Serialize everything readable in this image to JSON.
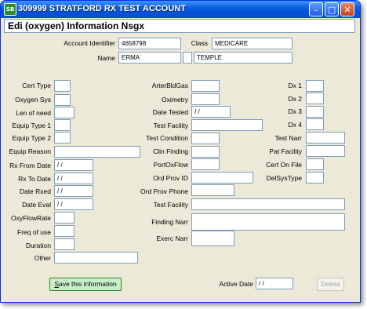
{
  "window": {
    "title": "309999 STRATFORD RX TEST ACCOUNT",
    "app_icon": "SB",
    "minimize_glyph": "–",
    "maximize_glyph": "□",
    "close_glyph": "✕"
  },
  "header": {
    "title": "Edi (oxygen) Information Nsgx"
  },
  "account": {
    "identifier_label": "Account Identifier",
    "identifier_value": "4658798",
    "class_label": "Class",
    "class_value": "MEDICARE",
    "name_label": "Name",
    "first_name": "ERMA",
    "middle_initial": "",
    "last_name": "TEMPLE"
  },
  "left_fields": {
    "cert_type": {
      "label": "Cert Type",
      "value": ""
    },
    "oxygen_sys": {
      "label": "Oxygen Sys",
      "value": ""
    },
    "len_of_need": {
      "label": "Len of need",
      "value": ""
    },
    "equip_type_1": {
      "label": "Equip  Type 1",
      "value": ""
    },
    "equip_type_2": {
      "label": "Equip  Type  2",
      "value": ""
    },
    "equip_reason": {
      "label": "Equip Reason",
      "value": ""
    },
    "rx_from_date": {
      "label": "Rx From Date",
      "value": " / /"
    },
    "rx_to_date": {
      "label": "Rx To Date",
      "value": " / /"
    },
    "date_rxed": {
      "label": "Date Rxed",
      "value": " / /"
    },
    "date_eval": {
      "label": "Date Eval",
      "value": " / /"
    },
    "oxy_flow_rate": {
      "label": "OxyFlowRate",
      "value": ""
    },
    "freq_of_use": {
      "label": "Freq of use",
      "value": ""
    },
    "duration": {
      "label": "Duration",
      "value": ""
    },
    "other": {
      "label": "Other",
      "value": ""
    }
  },
  "middle_fields": {
    "arter_bld_gas": {
      "label": "ArterBldGas",
      "value": ""
    },
    "oximetry": {
      "label": "Oximetry",
      "value": ""
    },
    "date_tested": {
      "label": "Date Tested",
      "value": " / /"
    },
    "test_facility": {
      "label": "Test Facility",
      "value": ""
    },
    "test_condition": {
      "label": "Test Condition",
      "value": ""
    },
    "clin_finding": {
      "label": "Clin Finding",
      "value": ""
    },
    "port_ox_flow": {
      "label": "PortOxFlow",
      "value": ""
    },
    "ord_prov_id": {
      "label": "Ord Prov ID",
      "value": ""
    },
    "ord_prov_phone": {
      "label": "Ord Prov Phone",
      "value": ""
    },
    "test_facility_2": {
      "label": "Test Facility",
      "value": ""
    },
    "finding_narr": {
      "label": "Finding Narr",
      "value": ""
    },
    "exerc_narr": {
      "label": "Exerc Narr",
      "value": ""
    }
  },
  "right_fields": {
    "dx1": {
      "label": "Dx 1",
      "value": ""
    },
    "dx2": {
      "label": "Dx 2",
      "value": ""
    },
    "dx3": {
      "label": "Dx 3",
      "value": ""
    },
    "dx4": {
      "label": "Dx 4",
      "value": ""
    },
    "test_narr": {
      "label": "Test Narr",
      "value": ""
    },
    "pat_facility": {
      "label": "Pat Facility",
      "value": ""
    },
    "cert_on_file": {
      "label": "Cert On File",
      "value": ""
    },
    "del_sys_type": {
      "label": "DelSysType",
      "value": ""
    }
  },
  "footer": {
    "save_label_prefix": "S",
    "save_label_rest": "ave this information",
    "active_date_label": "Active Date",
    "active_date_value": " / /",
    "delete_label": "Delete"
  },
  "colors": {
    "titlebar": "#0a5fe0",
    "window_bg": "#ece9d8",
    "save_button_bg": "#c8f0c8",
    "field_border": "#7f9db9"
  }
}
